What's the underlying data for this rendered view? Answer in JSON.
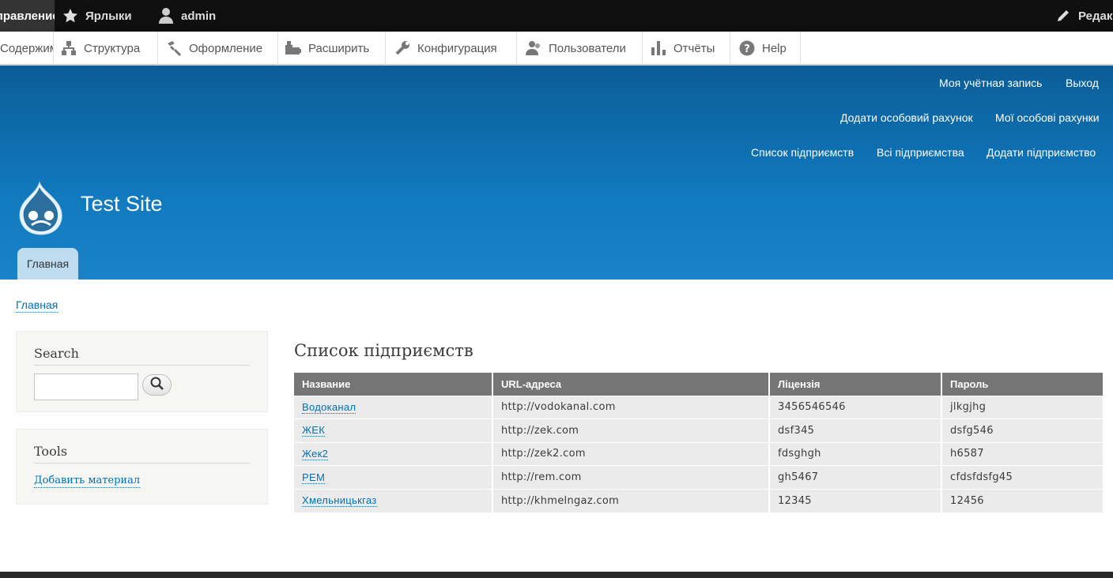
{
  "toolbar": {
    "manage_label": "Управление",
    "shortcuts_label": "Ярлыки",
    "user_label": "admin",
    "edit_label": "Редактировать"
  },
  "tray": {
    "items": [
      {
        "label": "Содержимое",
        "icon": "content-icon"
      },
      {
        "label": "Структура",
        "icon": "structure-icon"
      },
      {
        "label": "Оформление",
        "icon": "appearance-icon"
      },
      {
        "label": "Расширить",
        "icon": "extend-icon"
      },
      {
        "label": "Конфигурация",
        "icon": "wrench-icon"
      },
      {
        "label": "Пользователи",
        "icon": "people-icon"
      },
      {
        "label": "Отчёты",
        "icon": "reports-icon"
      },
      {
        "label": "Help",
        "icon": "help-icon"
      }
    ]
  },
  "header": {
    "secondary_menu": [
      "Моя учётная запись",
      "Выход"
    ],
    "accounts_menu": [
      "Додати особовий рахунок",
      "Мої особові рахунки"
    ],
    "enterprise_menu": [
      "Список підприємств",
      "Всі підприємства",
      "Додати підприємство"
    ],
    "site_name": "Test Site",
    "primary_tab": "Главная"
  },
  "breadcrumb": "Главная",
  "sidebar": {
    "search": {
      "title": "Search",
      "placeholder": ""
    },
    "tools": {
      "title": "Tools",
      "link": "Добавить материал"
    }
  },
  "main": {
    "title": "Список підприємств",
    "columns": [
      "Название",
      "URL-адреса",
      "Ліцензія",
      "Пароль"
    ],
    "rows": [
      [
        "Водоканал",
        "http://vodokanal.com",
        "3456546546",
        "jlkgjhg"
      ],
      [
        "ЖЕК",
        "http://zek.com",
        "dsf345",
        "dsfg546"
      ],
      [
        "Жек2",
        "http://zek2.com",
        "fdsghgh",
        "h6587"
      ],
      [
        "PEM",
        "http://rem.com",
        "gh5467",
        "cfdsfdsfg45"
      ],
      [
        "Хмельницькгаз",
        "http://khmelngaz.com",
        "12345",
        "12456"
      ]
    ]
  },
  "colors": {
    "header_top": "#0a5d96",
    "header_bottom": "#1a83c8",
    "link": "#0071b3",
    "table_head": "#757575",
    "toolbar_bg": "#0f0f0f"
  }
}
